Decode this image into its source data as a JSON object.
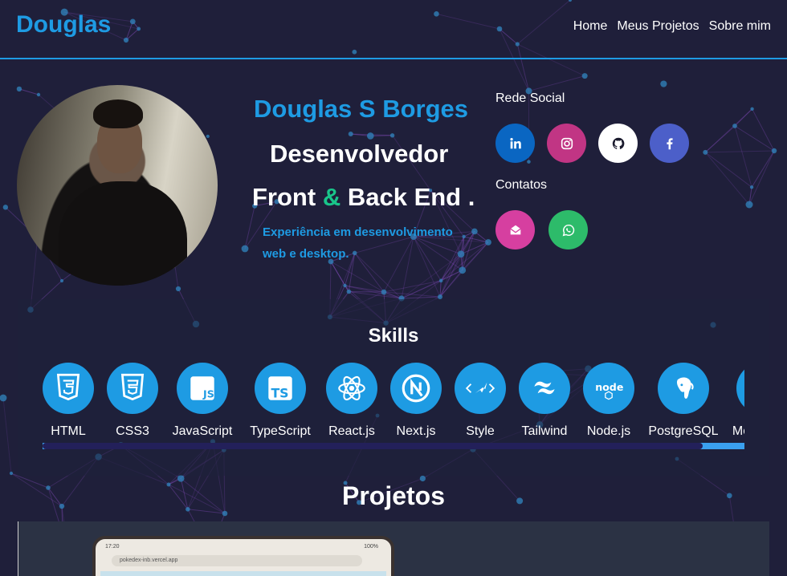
{
  "header": {
    "brand": "Douglas",
    "nav": [
      "Home",
      "Meus Projetos",
      "Sobre mim"
    ]
  },
  "hero": {
    "name": "Douglas S Borges",
    "role_line1": "Desenvolvedor",
    "role_line2_a": "Front",
    "role_line2_amp": "&",
    "role_line2_b": "Back End .",
    "experience": "Experiência em desenvolvimento web e desktop.",
    "social_title": "Rede Social",
    "contacts_title": "Contatos",
    "social": [
      {
        "name": "linkedin",
        "icon": "linkedin-icon",
        "color": "#0a66c2"
      },
      {
        "name": "instagram",
        "icon": "instagram-icon",
        "color": "#c13584"
      },
      {
        "name": "github",
        "icon": "github-icon",
        "color": "#ffffff"
      },
      {
        "name": "facebook",
        "icon": "facebook-icon",
        "color": "#4267b2"
      }
    ],
    "contacts": [
      {
        "name": "email",
        "icon": "envelope-icon",
        "color": "#d63fa0"
      },
      {
        "name": "whatsapp",
        "icon": "whatsapp-icon",
        "color": "#2dbb6a"
      }
    ]
  },
  "skills": {
    "title": "Skills",
    "items": [
      "HTML",
      "CSS3",
      "JavaScript",
      "TypeScript",
      "React.js",
      "Next.js",
      "Style",
      "Tailwind",
      "Node.js",
      "PostgreSQL",
      "Mo"
    ],
    "scroll_position": 0.94
  },
  "projects": {
    "title": "Projetos",
    "preview_time": "17:20",
    "preview_battery": "100%",
    "preview_url": "pokedex-inb.vercel.app"
  },
  "colors": {
    "accent": "#1e9be3",
    "amp": "#19c58a",
    "background": "#1f1f3a"
  }
}
